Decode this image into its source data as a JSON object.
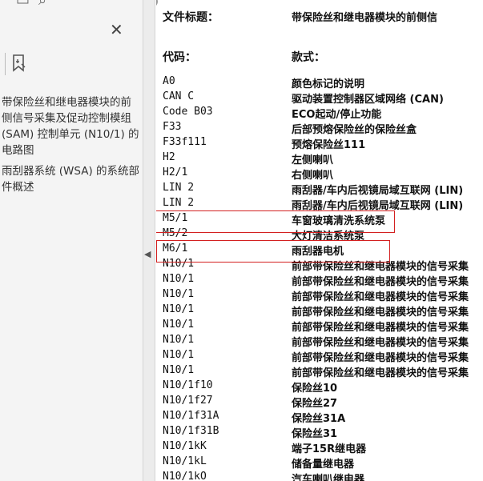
{
  "sidebar": {
    "bookmarks": [
      "带保险丝和继电器模块的前侧信号采集及促动控制模组 (SAM) 控制单元 (N10/1) 的电路图",
      "雨刮器系统 (WSA) 的系统部件概述"
    ]
  },
  "document": {
    "title_partial": "文件标题：",
    "title_value_partial": "带保险丝和继电器模块的前侧信",
    "col_code_header": "代码：",
    "col_desc_header": "款式：",
    "rows": [
      {
        "code": "A0",
        "desc": "颜色标记的说明"
      },
      {
        "code": "CAN C",
        "desc": "驱动装置控制器区域网络 (CAN)"
      },
      {
        "code": "Code B03",
        "desc": "ECO起动/停止功能"
      },
      {
        "code": "F33",
        "desc": "后部预熔保险丝的保险丝盒"
      },
      {
        "code": "F33f111",
        "desc": "预熔保险丝111"
      },
      {
        "code": "H2",
        "desc": "左侧喇叭"
      },
      {
        "code": "H2/1",
        "desc": "右侧喇叭"
      },
      {
        "code": "LIN 2",
        "desc": "雨刮器/车内后视镜局域互联网 (LIN)"
      },
      {
        "code": "LIN 2",
        "desc": "雨刮器/车内后视镜局域互联网 (LIN)"
      },
      {
        "code": "M5/1",
        "desc": "车窗玻璃清洗系统泵"
      },
      {
        "code": "M5/2",
        "desc": "大灯清洁系统泵"
      },
      {
        "code": "M6/1",
        "desc": "雨刮器电机"
      },
      {
        "code": "N10/1",
        "desc": "前部带保险丝和继电器模块的信号采集"
      },
      {
        "code": "N10/1",
        "desc": "前部带保险丝和继电器模块的信号采集"
      },
      {
        "code": "N10/1",
        "desc": "前部带保险丝和继电器模块的信号采集"
      },
      {
        "code": "N10/1",
        "desc": "前部带保险丝和继电器模块的信号采集"
      },
      {
        "code": "N10/1",
        "desc": "前部带保险丝和继电器模块的信号采集"
      },
      {
        "code": "N10/1",
        "desc": "前部带保险丝和继电器模块的信号采集"
      },
      {
        "code": "N10/1",
        "desc": "前部带保险丝和继电器模块的信号采集"
      },
      {
        "code": "N10/1",
        "desc": "前部带保险丝和继电器模块的信号采集"
      },
      {
        "code": "N10/1f10",
        "desc": "保险丝10"
      },
      {
        "code": "N10/1f27",
        "desc": "保险丝27"
      },
      {
        "code": "N10/1f31A",
        "desc": "保险丝31A"
      },
      {
        "code": "N10/1f31B",
        "desc": "保险丝31"
      },
      {
        "code": "N10/1kK",
        "desc": "端子15R继电器"
      },
      {
        "code": "N10/1kL",
        "desc": "储备量继电器"
      },
      {
        "code": "N10/1kO",
        "desc": "汽车喇叭继电器"
      }
    ]
  },
  "icons": {
    "close": "close-icon",
    "bookmark": "bookmark-icon",
    "collapse": "collapse-left-icon"
  },
  "colors": {
    "highlight_box": "#d32020"
  }
}
